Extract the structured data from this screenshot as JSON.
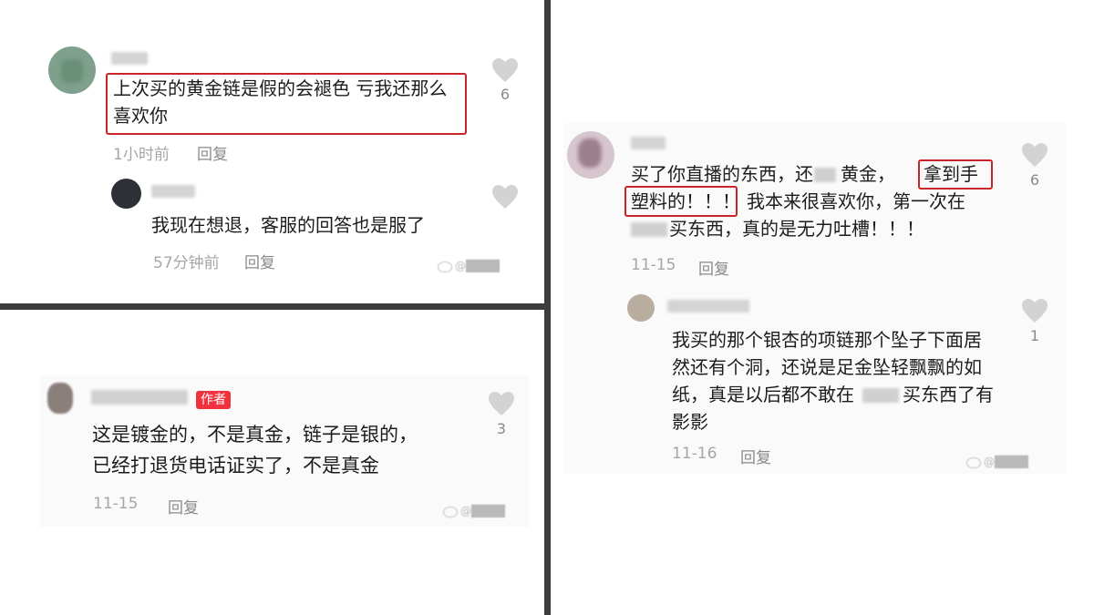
{
  "panel_top_left": {
    "comment": {
      "text_line1": "上次买的黄金链是假的会褪色 亏我还那么",
      "text_line2": "喜欢你",
      "time": "1小时前",
      "reply_label": "回复",
      "like_count": "6"
    },
    "reply": {
      "text": "我现在想退，客服的回答也是服了",
      "time": "57分钟前",
      "reply_label": "回复"
    }
  },
  "panel_bottom_left": {
    "badge": "作者",
    "comment": {
      "text_line1": "这是镀金的，不是真金，链子是银的，",
      "text_line2": "已经打退货电话证实了，不是真金",
      "time": "11-15",
      "reply_label": "回复",
      "like_count": "3"
    }
  },
  "panel_right": {
    "comment": {
      "line1_a": "买了你直播的东西，还",
      "line1_b": "黄金，",
      "line1_hl": "拿到手",
      "line2_hl": "塑料的！！！",
      "line2_rest": "我本来很喜欢你，第一次在",
      "line3": "买东西，真的是无力吐槽！！！",
      "time": "11-15",
      "reply_label": "回复",
      "like_count": "6"
    },
    "reply": {
      "line1": "我买的那个银杏的项链那个坠子下面居",
      "line2": "然还有个洞，还说是足金坠轻飘飘的如",
      "line3a": "纸，真是以后都不敢在",
      "line3b": "买东西了有",
      "line4": "影影",
      "time": "11-16",
      "reply_label": "回复",
      "like_count": "1"
    }
  },
  "colors": {
    "highlight_box": "#c8242a",
    "badge_bg": "#f0323f",
    "divider": "#3d3d3d",
    "heart": "#d3d3d3"
  }
}
